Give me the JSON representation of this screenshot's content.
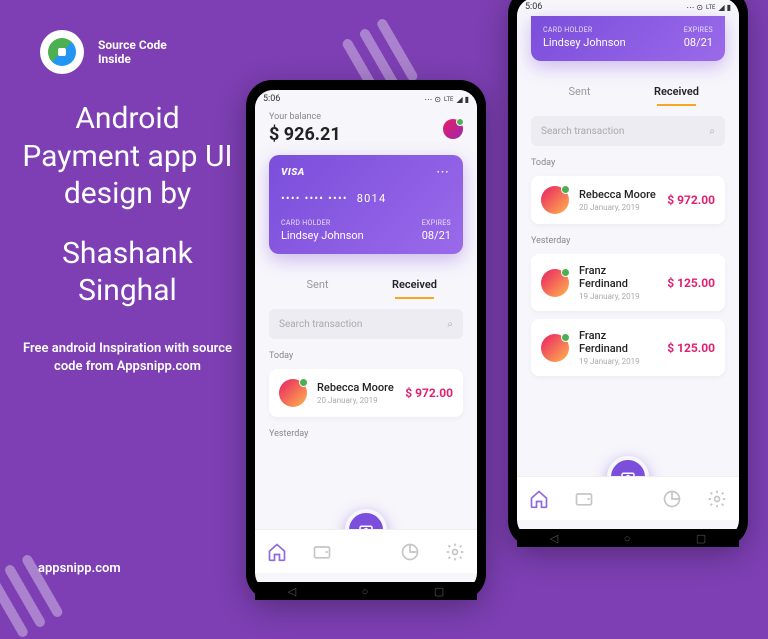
{
  "logo": {
    "line1": "Source Code",
    "line2": "Inside"
  },
  "hero": {
    "title": "Android Payment app UI design by",
    "author": "Shashank Singhal",
    "sub": "Free android Inspiration with source code from Appsnipp.com"
  },
  "site": "appsnipp.com",
  "status_time": "5:06",
  "balance": {
    "label": "Your balance",
    "value": "$ 926.21"
  },
  "card": {
    "brand": "VISA",
    "number_masked": "•••• •••• ••••",
    "number_last": "8014",
    "holder_label": "CARD HOLDER",
    "holder": "Lindsey Johnson",
    "expires_label": "EXPIRES",
    "expires": "08/21"
  },
  "tabs": {
    "sent": "Sent",
    "received": "Received"
  },
  "search": {
    "placeholder": "Search transaction"
  },
  "sections": {
    "today": "Today",
    "yesterday": "Yesterday"
  },
  "txn_today": [
    {
      "name": "Rebecca Moore",
      "date": "20 January, 2019",
      "amount": "$ 972.00"
    }
  ],
  "txn_yesterday": [
    {
      "name": "Franz Ferdinand",
      "date": "19 January, 2019",
      "amount": "$ 125.00"
    },
    {
      "name": "Franz Ferdinand",
      "date": "19 January, 2019",
      "amount": "$ 125.00"
    }
  ]
}
